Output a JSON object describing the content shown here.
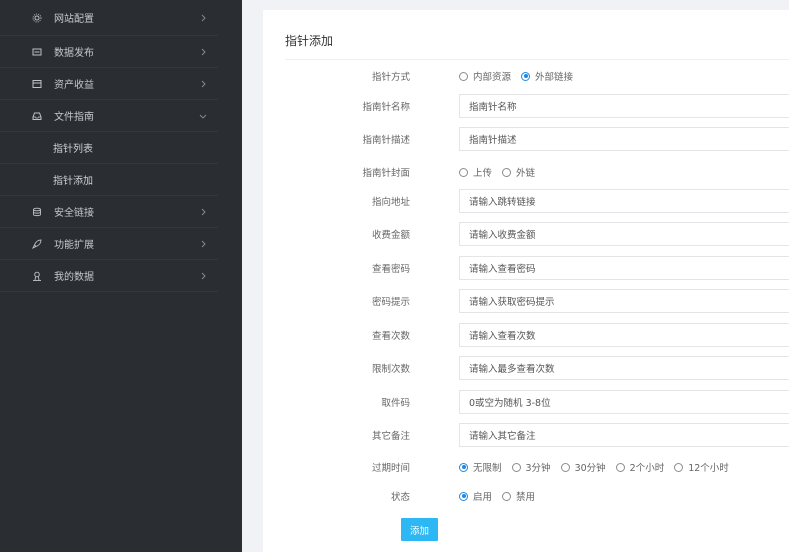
{
  "sidebar": {
    "items": [
      {
        "label": "网站配置",
        "icon": "gear-icon"
      },
      {
        "label": "数据发布",
        "icon": "monitor-icon"
      },
      {
        "label": "资产收益",
        "icon": "wallet-icon"
      },
      {
        "label": "文件指南",
        "icon": "inbox-icon",
        "expanded": true,
        "children": [
          "指针列表",
          "指针添加"
        ]
      },
      {
        "label": "安全链接",
        "icon": "database-icon"
      },
      {
        "label": "功能扩展",
        "icon": "rocket-icon"
      },
      {
        "label": "我的数据",
        "icon": "user-icon"
      }
    ]
  },
  "page": {
    "title": "指针添加"
  },
  "form": {
    "mode": {
      "label": "指针方式",
      "options": [
        "内部资源",
        "外部链接"
      ],
      "selected": "外部链接"
    },
    "name": {
      "label": "指南针名称",
      "placeholder": "指南针名称"
    },
    "desc": {
      "label": "指南针描述",
      "placeholder": "指南针描述"
    },
    "cover": {
      "label": "指南针封面",
      "options": [
        "上传",
        "外链"
      ],
      "selected": ""
    },
    "url": {
      "label": "指向地址",
      "placeholder": "请输入跳转链接"
    },
    "fee": {
      "label": "收费金额",
      "placeholder": "请输入收费金额"
    },
    "password": {
      "label": "查看密码",
      "placeholder": "请输入查看密码"
    },
    "hint": {
      "label": "密码提示",
      "placeholder": "请输入获取密码提示"
    },
    "views": {
      "label": "查看次数",
      "placeholder": "请输入查看次数"
    },
    "limit": {
      "label": "限制次数",
      "placeholder": "请输入最多查看次数"
    },
    "code": {
      "label": "取件码",
      "placeholder": "0或空为随机 3-8位"
    },
    "note": {
      "label": "其它备注",
      "placeholder": "请输入其它备注"
    },
    "expire": {
      "label": "过期时间",
      "options": [
        "无限制",
        "3分钟",
        "30分钟",
        "2个小时",
        "12个小时"
      ],
      "selected": "无限制"
    },
    "status": {
      "label": "状态",
      "options": [
        "启用",
        "禁用"
      ],
      "selected": "启用"
    },
    "submit_label": "添加"
  }
}
